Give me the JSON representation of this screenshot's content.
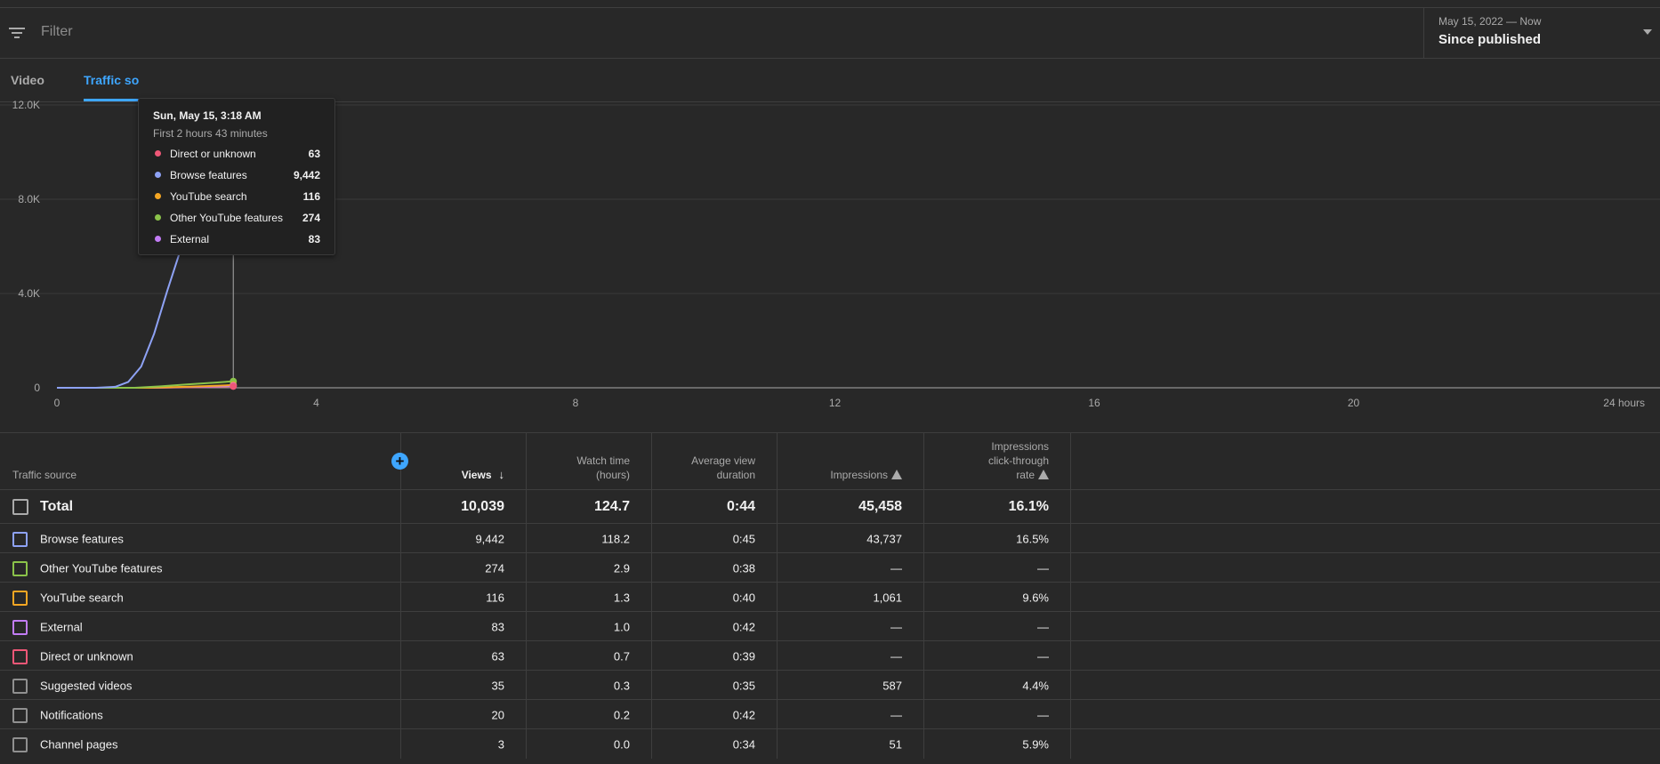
{
  "filter": {
    "placeholder": "Filter"
  },
  "date_picker": {
    "range": "May 15, 2022 — Now",
    "label": "Since published"
  },
  "tabs": [
    {
      "label": "Video"
    },
    {
      "label": "Traffic so"
    }
  ],
  "colors": {
    "accent": "#3ea6ff",
    "browse_features": "#8ea2f5",
    "other_youtube_features": "#8bc34a",
    "youtube_search": "#f5a623",
    "external": "#c27cf5",
    "direct_or_unknown": "#ef5777",
    "neutral": "#909090"
  },
  "tooltip": {
    "title": "Sun, May 15, 3:18 AM",
    "subtitle": "First 2 hours 43 minutes",
    "rows": [
      {
        "name": "Direct or unknown",
        "value": "63",
        "color": "#ef5777"
      },
      {
        "name": "Browse features",
        "value": "9,442",
        "color": "#8ea2f5"
      },
      {
        "name": "YouTube search",
        "value": "116",
        "color": "#f5a623"
      },
      {
        "name": "Other YouTube features",
        "value": "274",
        "color": "#8bc34a"
      },
      {
        "name": "External",
        "value": "83",
        "color": "#c27cf5"
      }
    ]
  },
  "chart_data": {
    "type": "line",
    "title": "",
    "xlabel": "",
    "ylabel": "",
    "xlim": [
      0,
      24
    ],
    "ylim": [
      0,
      12000
    ],
    "x_ticks": [
      {
        "v": 0,
        "label": "0"
      },
      {
        "v": 4,
        "label": "4"
      },
      {
        "v": 8,
        "label": "8"
      },
      {
        "v": 12,
        "label": "12"
      },
      {
        "v": 16,
        "label": "16"
      },
      {
        "v": 20,
        "label": "20"
      },
      {
        "v": 24,
        "label": "24 hours"
      }
    ],
    "y_ticks": [
      {
        "v": 0,
        "label": "0"
      },
      {
        "v": 4000,
        "label": "4.0K"
      },
      {
        "v": 8000,
        "label": "8.0K"
      },
      {
        "v": 12000,
        "label": "12.0K"
      }
    ],
    "grid": true,
    "hover_x": 2.72,
    "series": [
      {
        "key": "browse",
        "color": "#8ea2f5",
        "x": [
          0,
          0.6,
          0.9,
          1.1,
          1.3,
          1.5,
          1.7,
          1.9,
          2.1,
          2.3,
          2.5,
          2.72
        ],
        "y": [
          0,
          0,
          40,
          250,
          900,
          2300,
          4100,
          5800,
          7100,
          8000,
          8700,
          9442
        ]
      },
      {
        "key": "other",
        "color": "#8bc34a",
        "x": [
          0,
          1.2,
          1.6,
          2.0,
          2.4,
          2.72
        ],
        "y": [
          0,
          0,
          60,
          140,
          210,
          274
        ]
      },
      {
        "key": "search",
        "color": "#f5a623",
        "x": [
          0,
          1.4,
          2.0,
          2.4,
          2.72
        ],
        "y": [
          0,
          0,
          40,
          80,
          116
        ]
      },
      {
        "key": "external",
        "color": "#c27cf5",
        "x": [
          0,
          1.5,
          2.2,
          2.72
        ],
        "y": [
          0,
          0,
          40,
          83
        ]
      },
      {
        "key": "direct",
        "color": "#ef5777",
        "x": [
          0,
          1.5,
          2.2,
          2.72
        ],
        "y": [
          0,
          0,
          30,
          63
        ]
      }
    ]
  },
  "table": {
    "headers": {
      "source": "Traffic source",
      "views": "Views",
      "watch_time": "Watch time\n(hours)",
      "avg_duration": "Average view\nduration",
      "impressions": "Impressions",
      "ctr": "Impressions\nclick-through\nrate"
    },
    "total": {
      "source": "Total",
      "views": "10,039",
      "watch": "124.7",
      "avg": "0:44",
      "impr": "45,458",
      "ctr": "16.1%"
    },
    "rows": [
      {
        "source": "Browse features",
        "views": "9,442",
        "watch": "118.2",
        "avg": "0:45",
        "impr": "43,737",
        "ctr": "16.5%",
        "color": "#8ea2f5"
      },
      {
        "source": "Other YouTube features",
        "views": "274",
        "watch": "2.9",
        "avg": "0:38",
        "impr": "—",
        "ctr": "—",
        "color": "#8bc34a"
      },
      {
        "source": "YouTube search",
        "views": "116",
        "watch": "1.3",
        "avg": "0:40",
        "impr": "1,061",
        "ctr": "9.6%",
        "color": "#f5a623"
      },
      {
        "source": "External",
        "views": "83",
        "watch": "1.0",
        "avg": "0:42",
        "impr": "—",
        "ctr": "—",
        "color": "#c27cf5"
      },
      {
        "source": "Direct or unknown",
        "views": "63",
        "watch": "0.7",
        "avg": "0:39",
        "impr": "—",
        "ctr": "—",
        "color": "#ef5777"
      },
      {
        "source": "Suggested videos",
        "views": "35",
        "watch": "0.3",
        "avg": "0:35",
        "impr": "587",
        "ctr": "4.4%",
        "color": "#909090"
      },
      {
        "source": "Notifications",
        "views": "20",
        "watch": "0.2",
        "avg": "0:42",
        "impr": "—",
        "ctr": "—",
        "color": "#909090"
      },
      {
        "source": "Channel pages",
        "views": "3",
        "watch": "0.0",
        "avg": "0:34",
        "impr": "51",
        "ctr": "5.9%",
        "color": "#909090"
      }
    ]
  }
}
